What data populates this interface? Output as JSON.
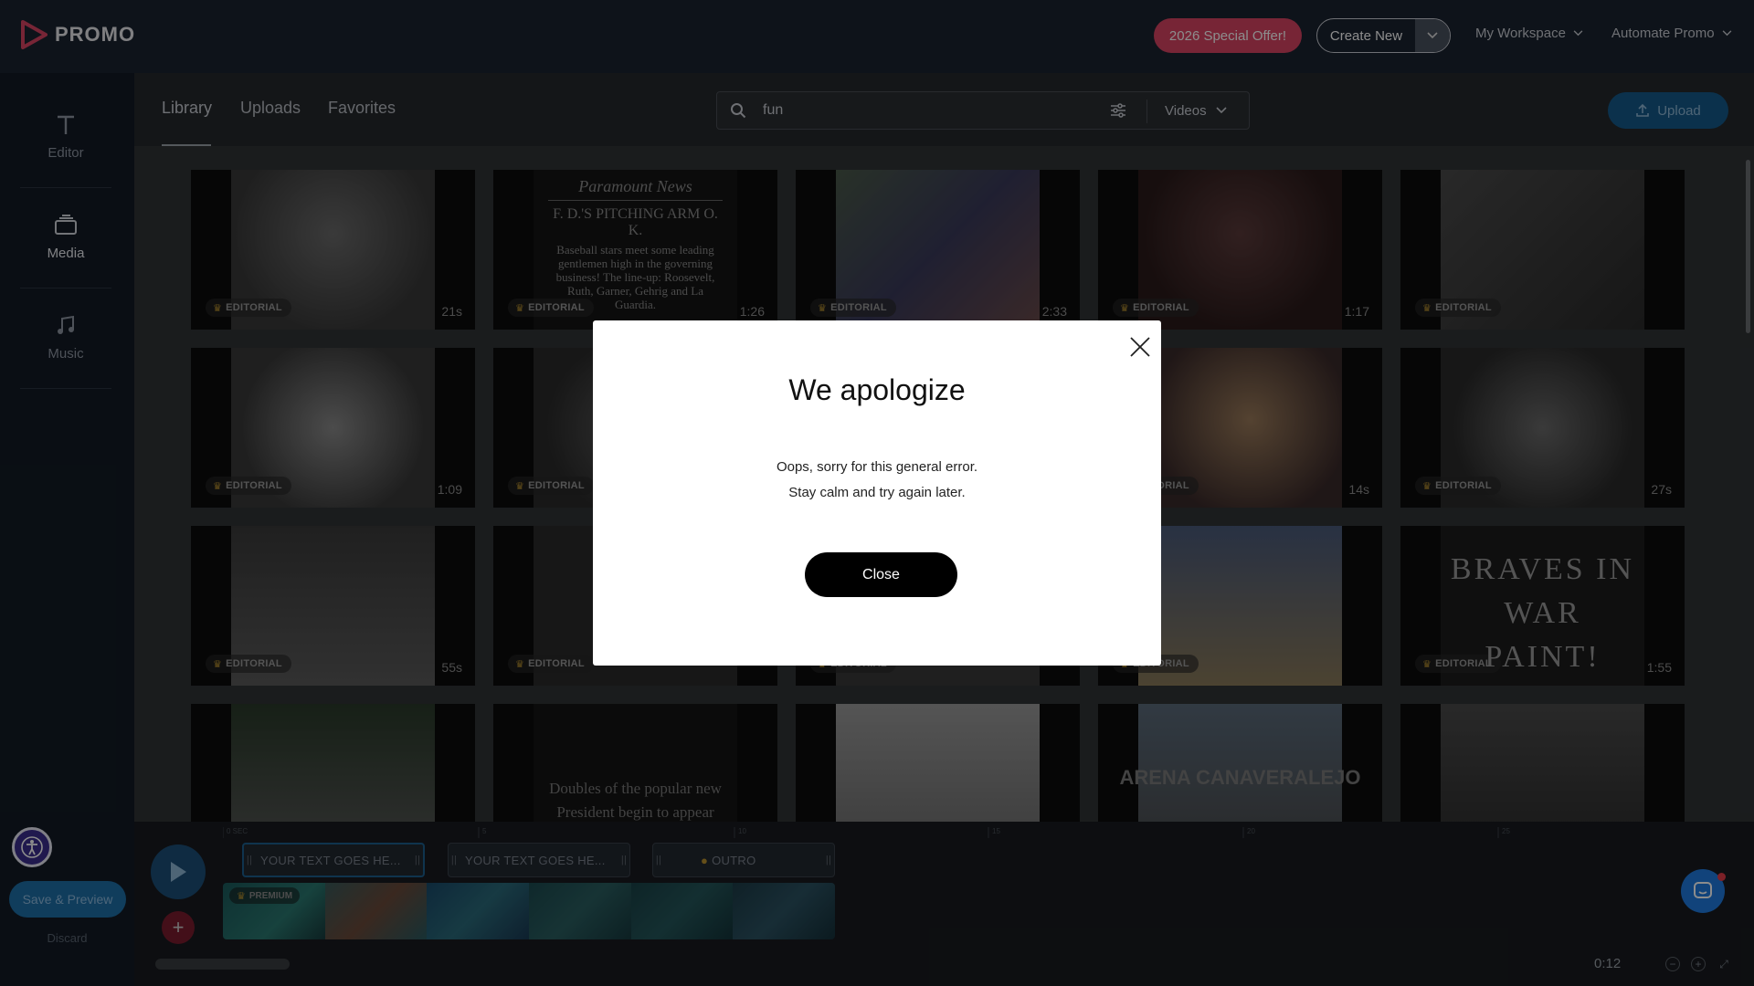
{
  "header": {
    "brand": "PROMO",
    "offer_label": "2026 Special Offer!",
    "create_label": "Create New",
    "workspace_label": "My Workspace",
    "automate_label": "Automate Promo"
  },
  "sidebar": {
    "items": [
      {
        "label": "Editor",
        "icon": "text-t-icon"
      },
      {
        "label": "Media",
        "icon": "media-stack-icon"
      },
      {
        "label": "Music",
        "icon": "music-note-icon"
      }
    ],
    "save_label": "Save & Preview",
    "discard_label": "Discard"
  },
  "library": {
    "tabs": [
      "Library",
      "Uploads",
      "Favorites"
    ],
    "active_tab": "Library",
    "search_value": "fun",
    "filter_label": "Videos",
    "upload_label": "Upload"
  },
  "tiles": {
    "badge_editorial": "EDITORIAL",
    "durations": [
      "21s",
      "1:26",
      "2:33",
      "1:17",
      "",
      "1:09",
      "",
      "",
      "14s",
      "27s",
      "55s",
      "",
      "",
      "",
      "1:55"
    ],
    "paramount_title": "Paramount News",
    "paramount_headline": "F. D.'S PITCHING ARM O. K.",
    "paramount_body": "Baseball stars meet some leading gentlemen high in the governing business! The line-up: Roosevelt, Ruth, Garner, Gehrig and La Guardia.",
    "braves_text": "BRAVES IN WAR PAINT!",
    "doubles_text": "Doubles of the popular new President begin to appear",
    "arena_text": "ARENA CANAVERALEJO"
  },
  "timeline": {
    "clips": [
      {
        "label": "YOUR TEXT GOES HE..."
      },
      {
        "label": "YOUR TEXT GOES HE..."
      },
      {
        "label": "OUTRO"
      }
    ],
    "premium_label": "PREMIUM",
    "time_readout": "0:12",
    "ruler_labels": [
      "0 SEC",
      "5",
      "10",
      "15",
      "20",
      "25"
    ]
  },
  "modal": {
    "title": "We apologize",
    "line1": "Oops, sorry for this general error.",
    "line2": "Stay calm and try again later.",
    "close_label": "Close"
  },
  "colors": {
    "accent": "#1f7be0",
    "offer": "#d94463",
    "modal_button": "#000000"
  }
}
